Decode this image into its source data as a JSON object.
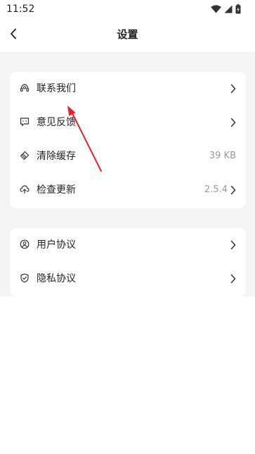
{
  "status_bar": {
    "time": "11:52"
  },
  "header": {
    "title": "设置"
  },
  "groups": [
    {
      "items": [
        {
          "label": "联系我们",
          "value": "",
          "icon": "headset-icon",
          "chevron": true
        },
        {
          "label": "意见反馈",
          "value": "",
          "icon": "feedback-icon",
          "chevron": true
        },
        {
          "label": "清除缓存",
          "value": "39 KB",
          "icon": "eraser-icon",
          "chevron": false
        },
        {
          "label": "检查更新",
          "value": "2.5.4",
          "icon": "cloud-update-icon",
          "chevron": true
        }
      ]
    },
    {
      "items": [
        {
          "label": "用户协议",
          "value": "",
          "icon": "user-circle-icon",
          "chevron": true
        },
        {
          "label": "隐私协议",
          "value": "",
          "icon": "shield-check-icon",
          "chevron": true
        }
      ]
    }
  ],
  "colors": {
    "background": "#f5f5f5",
    "card": "#ffffff",
    "text": "#222222",
    "secondary_text": "#9a9a9a",
    "annotation_arrow": "#e8222a"
  }
}
